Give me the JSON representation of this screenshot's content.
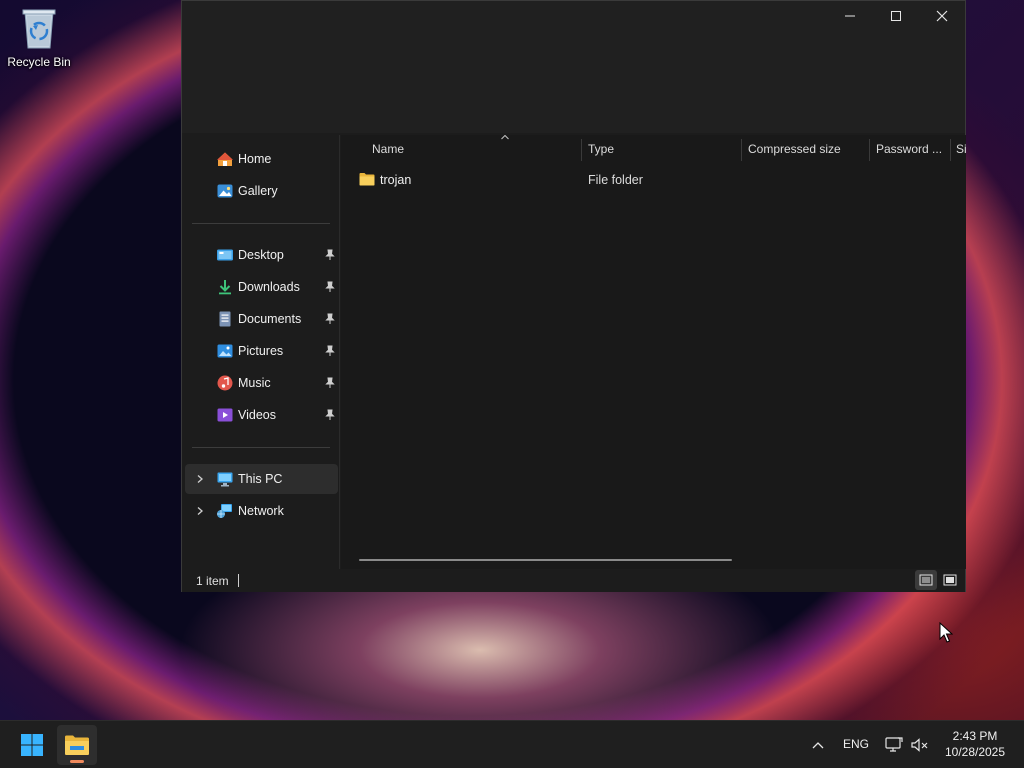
{
  "desktop": {
    "icons": [
      {
        "label": "Recycle Bin",
        "icon": "recycle-bin-icon"
      }
    ]
  },
  "window": {
    "controls": {
      "minimize": "minimize-icon",
      "maximize": "maximize-icon",
      "close": "close-icon"
    },
    "nav": {
      "quick": [
        {
          "label": "Home",
          "icon": "home-icon"
        },
        {
          "label": "Gallery",
          "icon": "gallery-icon"
        }
      ],
      "pinned": [
        {
          "label": "Desktop",
          "icon": "desktop-folder-icon",
          "pinned": true
        },
        {
          "label": "Downloads",
          "icon": "downloads-icon",
          "pinned": true
        },
        {
          "label": "Documents",
          "icon": "documents-icon",
          "pinned": true
        },
        {
          "label": "Pictures",
          "icon": "pictures-icon",
          "pinned": true
        },
        {
          "label": "Music",
          "icon": "music-icon",
          "pinned": true
        },
        {
          "label": "Videos",
          "icon": "videos-icon",
          "pinned": true
        }
      ],
      "locations": [
        {
          "label": "This PC",
          "icon": "this-pc-icon",
          "selected": true
        },
        {
          "label": "Network",
          "icon": "network-icon",
          "selected": false
        }
      ]
    },
    "columns": [
      "Name",
      "Type",
      "Compressed size",
      "Password ...",
      "Si"
    ],
    "files": [
      {
        "name": "trojan",
        "type": "File folder",
        "icon": "folder-icon"
      }
    ],
    "status": {
      "count": "1 item"
    }
  },
  "taskbar": {
    "lang": "ENG",
    "time": "2:43 PM",
    "date": "10/28/2025",
    "accent": "#f08a5d"
  }
}
